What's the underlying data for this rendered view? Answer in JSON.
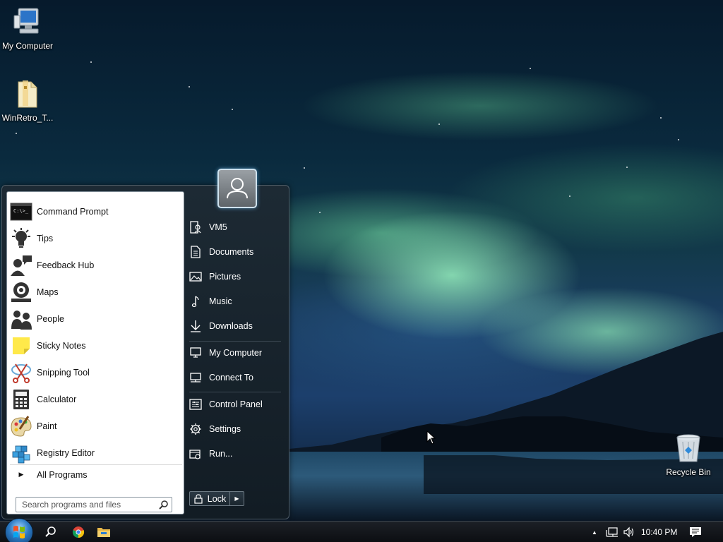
{
  "desktop": {
    "icons": [
      {
        "label": "My Computer"
      },
      {
        "label": "WinRetro_T..."
      },
      {
        "label": "Recycle Bin"
      }
    ]
  },
  "start_menu": {
    "programs": [
      {
        "label": "Command Prompt",
        "icon": "command-prompt-icon"
      },
      {
        "label": "Tips",
        "icon": "lightbulb-icon"
      },
      {
        "label": "Feedback Hub",
        "icon": "feedback-hub-icon"
      },
      {
        "label": "Maps",
        "icon": "maps-icon"
      },
      {
        "label": "People",
        "icon": "people-icon"
      },
      {
        "label": "Sticky Notes",
        "icon": "sticky-notes-icon"
      },
      {
        "label": "Snipping Tool",
        "icon": "scissors-icon"
      },
      {
        "label": "Calculator",
        "icon": "calculator-icon"
      },
      {
        "label": "Paint",
        "icon": "paint-palette-icon"
      },
      {
        "label": "Registry Editor",
        "icon": "registry-cubes-icon"
      }
    ],
    "all_programs": "All Programs",
    "search_placeholder": "Search programs and files",
    "places": [
      {
        "label": "VM5",
        "icon": "user-folder-icon"
      },
      {
        "label": "Documents",
        "icon": "document-icon"
      },
      {
        "label": "Pictures",
        "icon": "picture-icon"
      },
      {
        "label": "Music",
        "icon": "music-note-icon"
      },
      {
        "label": "Downloads",
        "icon": "download-arrow-icon"
      },
      {
        "label": "My Computer",
        "icon": "computer-monitor-icon"
      },
      {
        "label": "Connect To",
        "icon": "connect-icon"
      },
      {
        "label": "Control Panel",
        "icon": "control-panel-icon"
      },
      {
        "label": "Settings",
        "icon": "gear-icon"
      },
      {
        "label": "Run...",
        "icon": "run-icon"
      }
    ],
    "lock_label": "Lock"
  },
  "taskbar": {
    "clock": "10:40 PM",
    "pinned": [
      {
        "icon": "search-icon"
      },
      {
        "icon": "chrome-icon"
      },
      {
        "icon": "file-explorer-icon"
      }
    ],
    "tray": [
      {
        "icon": "chevron-up-icon"
      },
      {
        "icon": "network-icon"
      },
      {
        "icon": "volume-icon"
      },
      {
        "icon": "action-center-icon"
      }
    ]
  },
  "colors": {
    "start_menu_bg": "#121c24",
    "aurora_green": "#96f0be",
    "taskbar_bg": "#0c0e12"
  }
}
